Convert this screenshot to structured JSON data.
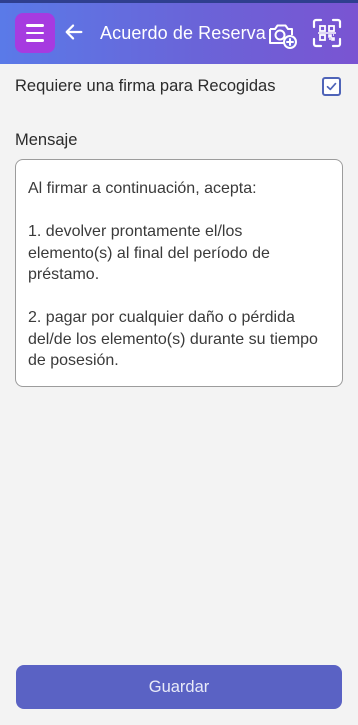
{
  "header": {
    "title": "Acuerdo de Reserva",
    "menu_icon": "hamburger-icon",
    "back_icon": "arrow-left-icon",
    "camera_icon": "camera-add-icon",
    "scan_icon": "qr-scan-icon",
    "menu_button_color": "#a63be0"
  },
  "signature": {
    "label": "Requiere una firma para Recogidas",
    "checked": true
  },
  "message": {
    "label": "Mensaje",
    "value": "Al firmar a continuación, acepta:\n\n1. devolver prontamente el/los elemento(s) al final del período de préstamo.\n\n2. pagar por cualquier daño o pérdida del/de los elemento(s) durante su tiempo de posesión."
  },
  "footer": {
    "save_label": "Guardar",
    "save_color": "#5a62c4"
  }
}
